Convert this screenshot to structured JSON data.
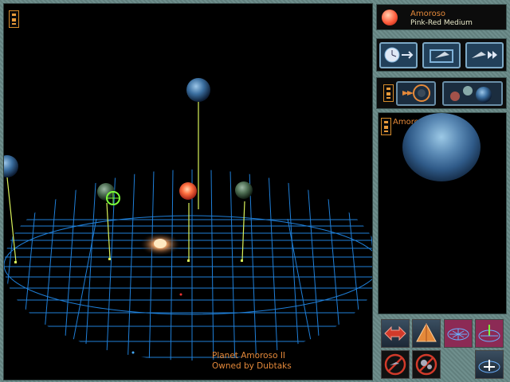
{
  "star": {
    "name": "Amoroso",
    "type": "Pink-Red Medium"
  },
  "selected_planet": {
    "name": "Amoroso II"
  },
  "status": {
    "line1": "Planet Amoroso II",
    "line2": "Owned by Dubtaks"
  },
  "colors": {
    "accent": "#e4893a",
    "grid": "#1f7fd8",
    "stalk": "#d9f25a"
  }
}
